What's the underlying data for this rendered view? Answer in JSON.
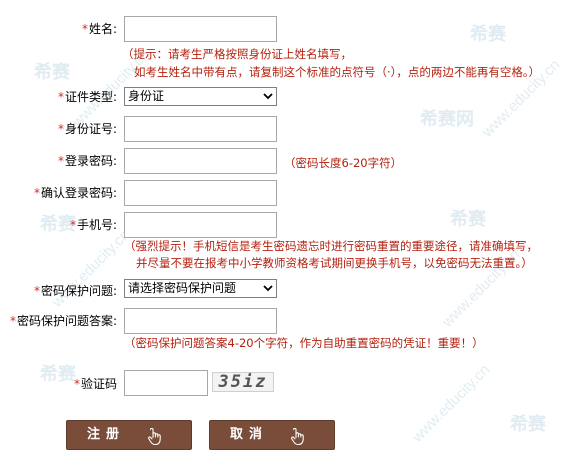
{
  "watermarks": {
    "brand": "希赛",
    "brand_net": "希赛网",
    "url": "www.educity.cn"
  },
  "form": {
    "name": {
      "label": "姓名:",
      "value": ""
    },
    "name_hint": [
      "（提示：请考生严格按照身份证上姓名填写，",
      "如考生姓名中带有点，请复制这个标准的点符号（·），点的两边不能再有空格。）"
    ],
    "id_type": {
      "label": "证件类型:",
      "selected": "身份证"
    },
    "id_number": {
      "label": "身份证号:",
      "value": ""
    },
    "password": {
      "label": "登录密码:",
      "value": "",
      "hint": "（密码长度6-20字符）"
    },
    "confirm_password": {
      "label": "确认登录密码:",
      "value": ""
    },
    "phone": {
      "label": "手机号:",
      "value": ""
    },
    "phone_hint": [
      "（强烈提示！手机短信是考生密码遗忘时进行密码重置的重要途径，请准确填写，",
      "并尽量不要在报考中小学教师资格考试期间更换手机号，以免密码无法重置。）"
    ],
    "security_question": {
      "label": "密码保护问题:",
      "selected": "请选择密码保护问题"
    },
    "security_answer": {
      "label": "密码保护问题答案:",
      "value": ""
    },
    "security_hint": "（密码保护问题答案4-20个字符，作为自助重置密码的凭证！重要！）",
    "captcha": {
      "label": "验证码",
      "value": "",
      "image_text": "35iz"
    }
  },
  "buttons": {
    "register": "注册",
    "cancel": "取消"
  },
  "colors": {
    "required_star": "#d12a2a",
    "hint_text": "#b5210f",
    "button_bg": "#7a4d3a"
  }
}
